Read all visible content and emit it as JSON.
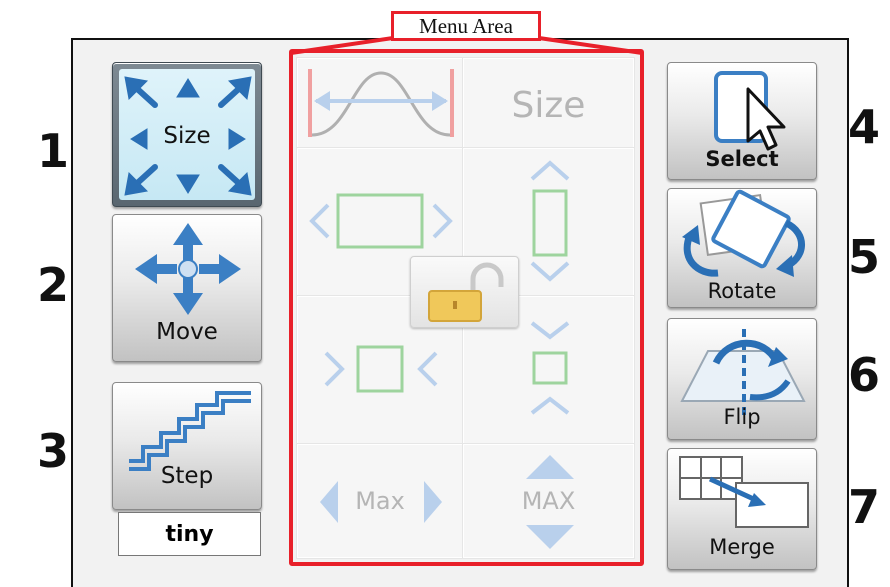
{
  "annotation": {
    "menu_area_label": "Menu Area",
    "frame_color": "#e8202a"
  },
  "numbers": [
    "1",
    "2",
    "3",
    "4",
    "5",
    "6",
    "7"
  ],
  "left_tools": [
    {
      "label": "Size",
      "icon": "resize-arrows-icon",
      "active": true
    },
    {
      "label": "Move",
      "icon": "move-cross-icon",
      "active": false
    },
    {
      "label": "Step",
      "icon": "stairs-icon",
      "active": false
    }
  ],
  "step_value": "tiny",
  "right_tools": [
    {
      "label": "Select",
      "icon": "cursor-select-icon"
    },
    {
      "label": "Rotate",
      "icon": "rotate-icon"
    },
    {
      "label": "Flip",
      "icon": "flip-icon"
    },
    {
      "label": "Merge",
      "icon": "merge-windows-icon"
    }
  ],
  "menu_cells": {
    "size_label": "Size",
    "max_label": "Max",
    "max_vertical_label": "MAX"
  },
  "colors": {
    "active_tile": "#cdeef8",
    "arrow_blue": "#2a6fb5",
    "disabled_green": "#9ed49e",
    "disabled_blue": "#b9d0ec",
    "lock_gold": "#f0c85a"
  }
}
